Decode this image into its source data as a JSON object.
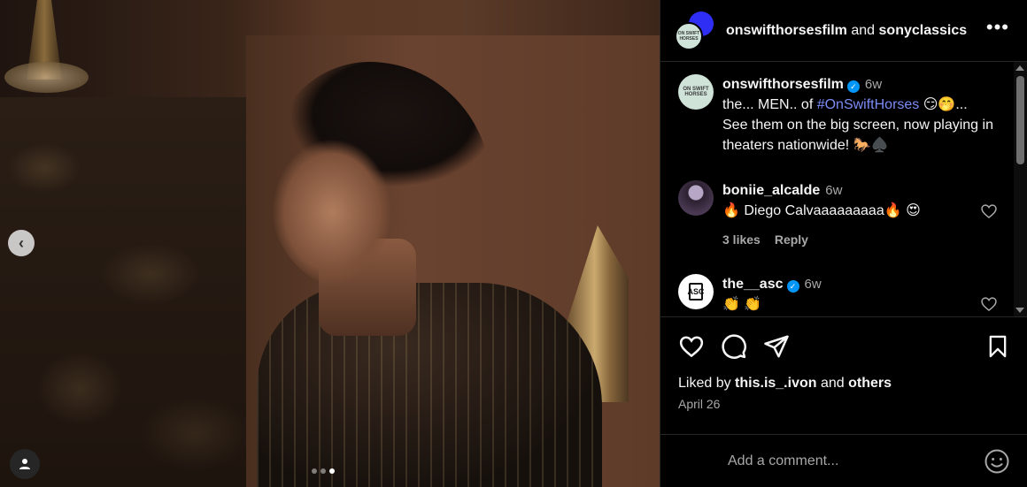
{
  "media": {
    "carousel_dots": 3,
    "active_dot": 2
  },
  "header": {
    "user1": "onswifthorsesfilm",
    "joiner": "and",
    "user2": "sonyclassics",
    "avatar_text": "ON SWIFT HORSES",
    "more": "•••"
  },
  "caption": {
    "avatar_text": "ON SWIFT HORSES",
    "username": "onswifthorsesfilm",
    "time": "6w",
    "text_prefix": "the... MEN.. of ",
    "hashtag": "#OnSwiftHorses",
    "text_suffix": " 😏🤭...",
    "text_line2": "See them on the big screen, now playing in theaters nationwide! 🐎♠️"
  },
  "comments": [
    {
      "username": "boniie_alcalde",
      "time": "6w",
      "text": "🔥 Diego Calvaaaaaaaaa🔥 😍",
      "likes": "3 likes",
      "reply": "Reply"
    },
    {
      "username": "the__asc",
      "time": "6w",
      "avatar_text": "ASC",
      "text": "👏 👏"
    }
  ],
  "footer": {
    "liked_prefix": "Liked by ",
    "liked_user": "this.is_.ivon",
    "liked_joiner": " and ",
    "liked_others": "others",
    "date": "April 26",
    "comment_placeholder": "Add a comment..."
  }
}
